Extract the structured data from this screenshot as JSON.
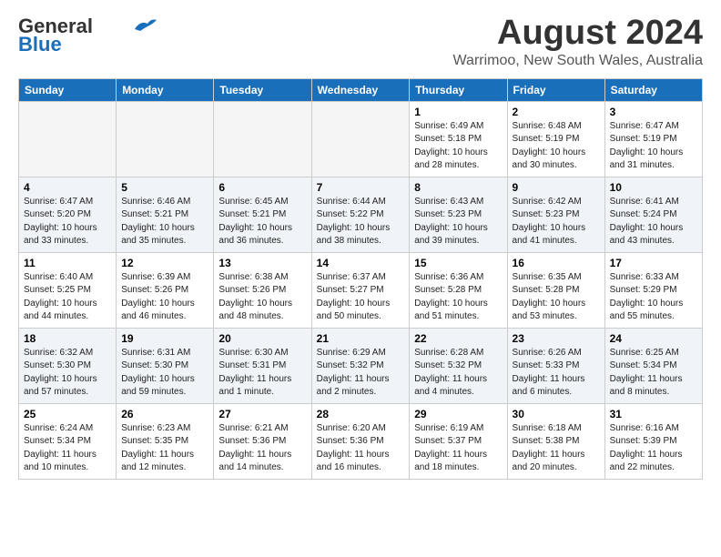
{
  "header": {
    "logo_general": "General",
    "logo_blue": "Blue",
    "month_title": "August 2024",
    "location": "Warrimoo, New South Wales, Australia"
  },
  "days_of_week": [
    "Sunday",
    "Monday",
    "Tuesday",
    "Wednesday",
    "Thursday",
    "Friday",
    "Saturday"
  ],
  "weeks": [
    {
      "row_class": "row-odd",
      "days": [
        {
          "num": "",
          "info": "",
          "empty": true
        },
        {
          "num": "",
          "info": "",
          "empty": true
        },
        {
          "num": "",
          "info": "",
          "empty": true
        },
        {
          "num": "",
          "info": "",
          "empty": true
        },
        {
          "num": "1",
          "info": "Sunrise: 6:49 AM\nSunset: 5:18 PM\nDaylight: 10 hours\nand 28 minutes.",
          "empty": false
        },
        {
          "num": "2",
          "info": "Sunrise: 6:48 AM\nSunset: 5:19 PM\nDaylight: 10 hours\nand 30 minutes.",
          "empty": false
        },
        {
          "num": "3",
          "info": "Sunrise: 6:47 AM\nSunset: 5:19 PM\nDaylight: 10 hours\nand 31 minutes.",
          "empty": false
        }
      ]
    },
    {
      "row_class": "row-even",
      "days": [
        {
          "num": "4",
          "info": "Sunrise: 6:47 AM\nSunset: 5:20 PM\nDaylight: 10 hours\nand 33 minutes.",
          "empty": false
        },
        {
          "num": "5",
          "info": "Sunrise: 6:46 AM\nSunset: 5:21 PM\nDaylight: 10 hours\nand 35 minutes.",
          "empty": false
        },
        {
          "num": "6",
          "info": "Sunrise: 6:45 AM\nSunset: 5:21 PM\nDaylight: 10 hours\nand 36 minutes.",
          "empty": false
        },
        {
          "num": "7",
          "info": "Sunrise: 6:44 AM\nSunset: 5:22 PM\nDaylight: 10 hours\nand 38 minutes.",
          "empty": false
        },
        {
          "num": "8",
          "info": "Sunrise: 6:43 AM\nSunset: 5:23 PM\nDaylight: 10 hours\nand 39 minutes.",
          "empty": false
        },
        {
          "num": "9",
          "info": "Sunrise: 6:42 AM\nSunset: 5:23 PM\nDaylight: 10 hours\nand 41 minutes.",
          "empty": false
        },
        {
          "num": "10",
          "info": "Sunrise: 6:41 AM\nSunset: 5:24 PM\nDaylight: 10 hours\nand 43 minutes.",
          "empty": false
        }
      ]
    },
    {
      "row_class": "row-odd",
      "days": [
        {
          "num": "11",
          "info": "Sunrise: 6:40 AM\nSunset: 5:25 PM\nDaylight: 10 hours\nand 44 minutes.",
          "empty": false
        },
        {
          "num": "12",
          "info": "Sunrise: 6:39 AM\nSunset: 5:26 PM\nDaylight: 10 hours\nand 46 minutes.",
          "empty": false
        },
        {
          "num": "13",
          "info": "Sunrise: 6:38 AM\nSunset: 5:26 PM\nDaylight: 10 hours\nand 48 minutes.",
          "empty": false
        },
        {
          "num": "14",
          "info": "Sunrise: 6:37 AM\nSunset: 5:27 PM\nDaylight: 10 hours\nand 50 minutes.",
          "empty": false
        },
        {
          "num": "15",
          "info": "Sunrise: 6:36 AM\nSunset: 5:28 PM\nDaylight: 10 hours\nand 51 minutes.",
          "empty": false
        },
        {
          "num": "16",
          "info": "Sunrise: 6:35 AM\nSunset: 5:28 PM\nDaylight: 10 hours\nand 53 minutes.",
          "empty": false
        },
        {
          "num": "17",
          "info": "Sunrise: 6:33 AM\nSunset: 5:29 PM\nDaylight: 10 hours\nand 55 minutes.",
          "empty": false
        }
      ]
    },
    {
      "row_class": "row-even",
      "days": [
        {
          "num": "18",
          "info": "Sunrise: 6:32 AM\nSunset: 5:30 PM\nDaylight: 10 hours\nand 57 minutes.",
          "empty": false
        },
        {
          "num": "19",
          "info": "Sunrise: 6:31 AM\nSunset: 5:30 PM\nDaylight: 10 hours\nand 59 minutes.",
          "empty": false
        },
        {
          "num": "20",
          "info": "Sunrise: 6:30 AM\nSunset: 5:31 PM\nDaylight: 11 hours\nand 1 minute.",
          "empty": false
        },
        {
          "num": "21",
          "info": "Sunrise: 6:29 AM\nSunset: 5:32 PM\nDaylight: 11 hours\nand 2 minutes.",
          "empty": false
        },
        {
          "num": "22",
          "info": "Sunrise: 6:28 AM\nSunset: 5:32 PM\nDaylight: 11 hours\nand 4 minutes.",
          "empty": false
        },
        {
          "num": "23",
          "info": "Sunrise: 6:26 AM\nSunset: 5:33 PM\nDaylight: 11 hours\nand 6 minutes.",
          "empty": false
        },
        {
          "num": "24",
          "info": "Sunrise: 6:25 AM\nSunset: 5:34 PM\nDaylight: 11 hours\nand 8 minutes.",
          "empty": false
        }
      ]
    },
    {
      "row_class": "row-odd",
      "days": [
        {
          "num": "25",
          "info": "Sunrise: 6:24 AM\nSunset: 5:34 PM\nDaylight: 11 hours\nand 10 minutes.",
          "empty": false
        },
        {
          "num": "26",
          "info": "Sunrise: 6:23 AM\nSunset: 5:35 PM\nDaylight: 11 hours\nand 12 minutes.",
          "empty": false
        },
        {
          "num": "27",
          "info": "Sunrise: 6:21 AM\nSunset: 5:36 PM\nDaylight: 11 hours\nand 14 minutes.",
          "empty": false
        },
        {
          "num": "28",
          "info": "Sunrise: 6:20 AM\nSunset: 5:36 PM\nDaylight: 11 hours\nand 16 minutes.",
          "empty": false
        },
        {
          "num": "29",
          "info": "Sunrise: 6:19 AM\nSunset: 5:37 PM\nDaylight: 11 hours\nand 18 minutes.",
          "empty": false
        },
        {
          "num": "30",
          "info": "Sunrise: 6:18 AM\nSunset: 5:38 PM\nDaylight: 11 hours\nand 20 minutes.",
          "empty": false
        },
        {
          "num": "31",
          "info": "Sunrise: 6:16 AM\nSunset: 5:39 PM\nDaylight: 11 hours\nand 22 minutes.",
          "empty": false
        }
      ]
    }
  ]
}
